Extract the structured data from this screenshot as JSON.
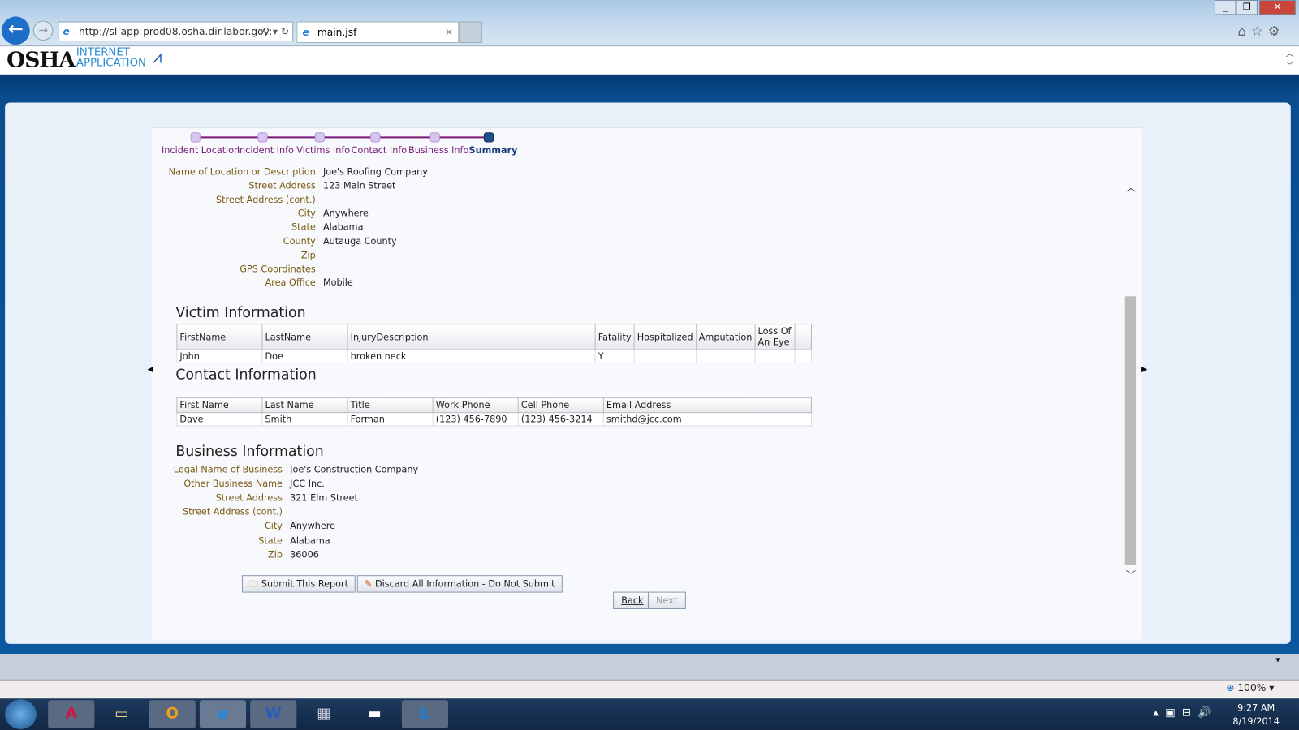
{
  "browser": {
    "url": "http://sl-app-prod08.osha.dir.labor.gov:",
    "tab_title": "main.jsf",
    "zoom": "100%"
  },
  "app": {
    "logo": "OSHA",
    "logo_sub1": "INTERNET",
    "logo_sub2": "APPLICATION"
  },
  "wizard": {
    "steps": [
      "Incident Location",
      "Incident Info",
      "Victims Info",
      "Contact Info",
      "Business Info",
      "Summary"
    ],
    "current": "Summary"
  },
  "location": {
    "rows": [
      {
        "label": "Name of Location or Description",
        "value": "Joe's Roofing Company"
      },
      {
        "label": "Street Address",
        "value": "123 Main Street"
      },
      {
        "label": "Street Address (cont.)",
        "value": ""
      },
      {
        "label": "City",
        "value": "Anywhere"
      },
      {
        "label": "State",
        "value": "Alabama"
      },
      {
        "label": "County",
        "value": "Autauga County"
      },
      {
        "label": "Zip",
        "value": ""
      },
      {
        "label": "GPS Coordinates",
        "value": ""
      },
      {
        "label": "Area Office",
        "value": "Mobile"
      }
    ]
  },
  "victim": {
    "title": "Victim Information",
    "headers": [
      "FirstName",
      "LastName",
      "InjuryDescription",
      "Fatality",
      "Hospitalized",
      "Amputation",
      "Loss Of An Eye"
    ],
    "rows": [
      [
        "John",
        "Doe",
        "broken neck",
        "Y",
        "",
        "",
        ""
      ]
    ]
  },
  "contact": {
    "title": "Contact Information",
    "headers": [
      "First Name",
      "Last Name",
      "Title",
      "Work Phone",
      "Cell Phone",
      "Email Address"
    ],
    "rows": [
      [
        "Dave",
        "Smith",
        "Forman",
        "(123) 456-7890",
        "(123) 456-3214",
        "smithd@jcc.com"
      ]
    ]
  },
  "business": {
    "title": "Business Information",
    "rows": [
      {
        "label": "Legal Name of Business",
        "value": "Joe's Construction Company"
      },
      {
        "label": "Other Business Name",
        "value": "JCC Inc."
      },
      {
        "label": "Street Address",
        "value": "321 Elm Street"
      },
      {
        "label": "Street Address (cont.)",
        "value": ""
      },
      {
        "label": "City",
        "value": "Anywhere"
      },
      {
        "label": "State",
        "value": "Alabama"
      },
      {
        "label": "Zip",
        "value": "36006"
      }
    ]
  },
  "actions": {
    "submit": "Submit This Report",
    "discard": "Discard All Information - Do Not Submit",
    "back": "Back",
    "next": "Next"
  },
  "taskbar": {
    "time": "9:27 AM",
    "date": "8/19/2014"
  }
}
